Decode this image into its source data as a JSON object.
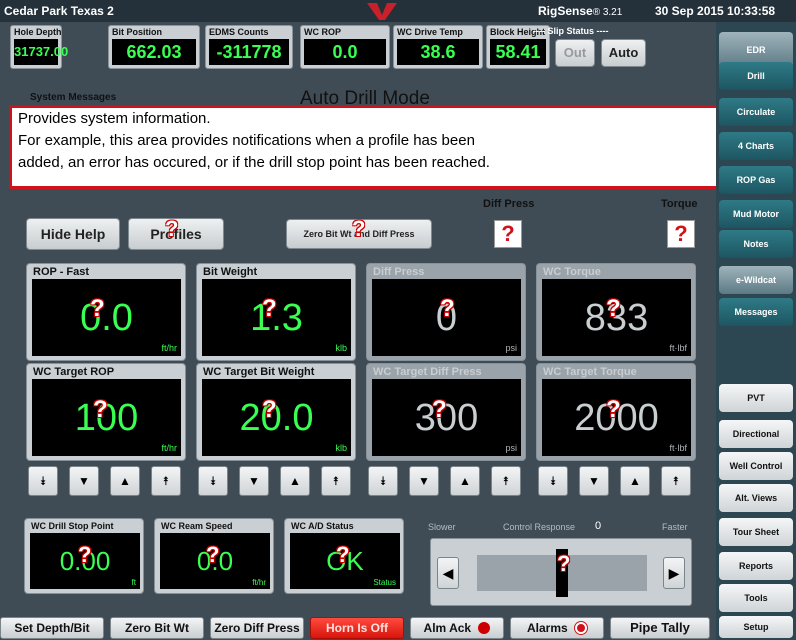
{
  "topbar": {
    "location": "Cedar Park Texas 2",
    "app": "RigSense",
    "version": "® 3.21",
    "datetime": "30 Sep 2015 10:33:58"
  },
  "readouts": [
    {
      "label": "Hole Depth",
      "value": "31737.00"
    },
    {
      "label": "Bit Position",
      "value": "662.03"
    },
    {
      "label": "EDMS Counts",
      "value": "-311778"
    },
    {
      "label": "WC ROP",
      "value": "0.0"
    },
    {
      "label": "WC Drive Temp",
      "value": "38.6"
    },
    {
      "label": "Block Height",
      "value": "58.41"
    }
  ],
  "slip": {
    "label": "---- Slip Status ----",
    "out": "Out",
    "auto": "Auto"
  },
  "status_area": {
    "system_messages": "System Messages",
    "mode": "Auto Drill Mode"
  },
  "help_text": {
    "line1": "Provides system information.",
    "line2": "For example, this area provides notifications when a profile has been",
    "line3": "added, an error has occured, or if the drill stop point has been reached."
  },
  "toolbar": {
    "hide_help": "Hide Help",
    "profiles": "Profiles",
    "zero_bit": "Zero Bit Wt and Diff Press",
    "diff_press": "Diff Press",
    "torque": "Torque"
  },
  "panels": [
    {
      "label": "ROP - Fast",
      "value": "0.0",
      "unit": "ft/hr"
    },
    {
      "label": "Bit Weight",
      "value": "1.3",
      "unit": "klb"
    },
    {
      "label": "Diff Press",
      "value": "0",
      "unit": "psi"
    },
    {
      "label": "WC Torque",
      "value": "833",
      "unit": "ft·lbf"
    },
    {
      "label": "WC Target ROP",
      "value": "100",
      "unit": "ft/hr"
    },
    {
      "label": "WC Target Bit Weight",
      "value": "20.0",
      "unit": "klb"
    },
    {
      "label": "WC Target Diff Press",
      "value": "300",
      "unit": "psi"
    },
    {
      "label": "WC Target Torque",
      "value": "2000",
      "unit": "ft·lbf"
    }
  ],
  "arrows": {
    "fast_down": "⯯",
    "down": "▼",
    "up": "▲",
    "fast_up": "⯭"
  },
  "small": [
    {
      "label": "WC Drill Stop Point",
      "value": "0.00",
      "unit": "ft"
    },
    {
      "label": "WC Ream Speed",
      "value": "0.0",
      "unit": "ft/hr"
    },
    {
      "label": "WC A/D Status",
      "value": "OK",
      "unit": "Status"
    }
  ],
  "control": {
    "slower": "Slower",
    "label": "Control Response",
    "value": "0",
    "faster": "Faster",
    "left": "◀",
    "right": "▶"
  },
  "help_marker": "?",
  "bottom": {
    "set_depth": "Set Depth/Bit",
    "zero_bit": "Zero Bit Wt",
    "zero_diff": "Zero Diff Press",
    "horn": "Horn Is Off",
    "alm_ack": "Alm Ack",
    "alarms": "Alarms",
    "pipe_tally": "Pipe Tally"
  },
  "nav": {
    "edr": "EDR",
    "drill": "Drill",
    "circulate": "Circulate",
    "charts": "4 Charts",
    "rop_gas": "ROP Gas",
    "mud_motor": "Mud Motor",
    "notes": "Notes",
    "wildcat": "e-Wildcat",
    "messages": "Messages",
    "pvt": "PVT",
    "directional": "Directional",
    "well_control": "Well Control",
    "alt_views": "Alt. Views",
    "tour_sheet": "Tour Sheet",
    "reports": "Reports",
    "tools": "Tools",
    "setup": "Setup"
  }
}
